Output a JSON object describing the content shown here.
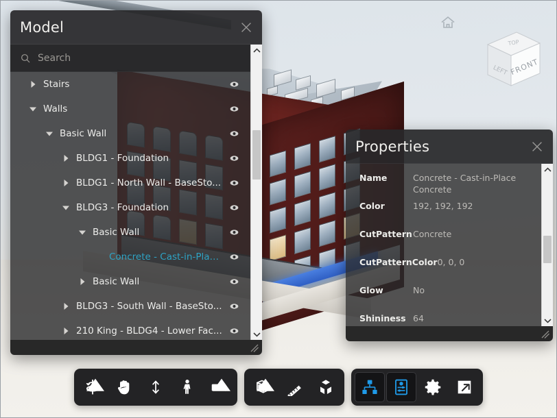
{
  "app": {
    "background_color": "#e6eaee",
    "accent_color": "#2196f3",
    "selection_color": "#2ea3c4"
  },
  "viewport": {
    "name": "3d-model-viewport",
    "home_icon": "home-icon",
    "viewcube": {
      "front_label": "FRONT",
      "left_label": "LEFT",
      "top_label": "TOP"
    }
  },
  "model_panel": {
    "title": "Model",
    "close_label": "×",
    "search": {
      "placeholder": "Search",
      "value": "",
      "icon": "search-icon"
    },
    "tree": [
      {
        "label": "Stairs",
        "depth": 1,
        "state": "collapsed",
        "selected": false
      },
      {
        "label": "Walls",
        "depth": 1,
        "state": "expanded",
        "selected": false
      },
      {
        "label": "Basic Wall",
        "depth": 2,
        "state": "expanded",
        "selected": false
      },
      {
        "label": "BLDG1 - Foundation",
        "depth": 3,
        "state": "collapsed",
        "selected": false
      },
      {
        "label": "BLDG1 - North Wall - BaseSto...",
        "depth": 3,
        "state": "collapsed",
        "selected": false
      },
      {
        "label": "BLDG3 - Foundation",
        "depth": 3,
        "state": "expanded",
        "selected": false
      },
      {
        "label": "Basic Wall",
        "depth": 4,
        "state": "expanded",
        "selected": false
      },
      {
        "label": "Concrete - Cast-in-Place ...",
        "depth": 5,
        "state": "leaf",
        "selected": true
      },
      {
        "label": "Basic Wall",
        "depth": 4,
        "state": "collapsed",
        "selected": false
      },
      {
        "label": "BLDG3 - South Wall - BaseSto...",
        "depth": 3,
        "state": "collapsed",
        "selected": false
      },
      {
        "label": "210 King - BLDG4 - Lower Fac...",
        "depth": 3,
        "state": "collapsed",
        "selected": false
      }
    ],
    "visibility_icon": "eye-icon",
    "scrollbar": {
      "up_icon": "chevron-up-icon",
      "down_icon": "chevron-down-icon"
    },
    "resize_handle": "resize-grip-icon"
  },
  "properties_panel": {
    "title": "Properties",
    "close_label": "×",
    "rows": [
      {
        "key": "Name",
        "value": "Concrete - Cast-in-Place Concrete"
      },
      {
        "key": "Color",
        "value": "192, 192, 192"
      },
      {
        "key": "CutPattern",
        "value": "Concrete"
      },
      {
        "key": "CutPatternColor",
        "value": "0, 0, 0"
      },
      {
        "key": "Glow",
        "value": "No"
      },
      {
        "key": "Shininess",
        "value": "64"
      }
    ],
    "scrollbar": {
      "up_icon": "chevron-up-icon",
      "down_icon": "chevron-down-icon"
    },
    "resize_handle": "resize-grip-icon"
  },
  "toolbar": {
    "groups": [
      {
        "name": "navigation-tools",
        "buttons": [
          {
            "name": "orbit-tool",
            "icon": "orbit-icon",
            "active": false,
            "has_menu": true
          },
          {
            "name": "pan-tool",
            "icon": "hand-icon",
            "active": false,
            "has_menu": false
          },
          {
            "name": "zoom-tool",
            "icon": "zoom-arrows-icon",
            "active": false,
            "has_menu": false
          },
          {
            "name": "walk-tool",
            "icon": "walk-person-icon",
            "active": false,
            "has_menu": false
          },
          {
            "name": "camera-tool",
            "icon": "camera-icon",
            "active": false,
            "has_menu": true
          }
        ]
      },
      {
        "name": "model-tools",
        "buttons": [
          {
            "name": "section-box-tool",
            "icon": "section-box-icon",
            "active": false,
            "has_menu": true
          },
          {
            "name": "measure-tool",
            "icon": "ruler-icon",
            "active": false,
            "has_menu": false
          },
          {
            "name": "explode-tool",
            "icon": "explode-cube-icon",
            "active": false,
            "has_menu": false
          }
        ]
      },
      {
        "name": "panel-tools",
        "buttons": [
          {
            "name": "model-tree-toggle",
            "icon": "tree-hierarchy-icon",
            "active": true,
            "has_menu": false
          },
          {
            "name": "properties-toggle",
            "icon": "properties-icon",
            "active": true,
            "has_menu": false
          },
          {
            "name": "settings-button",
            "icon": "gear-icon",
            "active": false,
            "has_menu": false
          },
          {
            "name": "fullscreen-button",
            "icon": "expand-arrow-icon",
            "active": false,
            "has_menu": false
          }
        ]
      }
    ]
  }
}
